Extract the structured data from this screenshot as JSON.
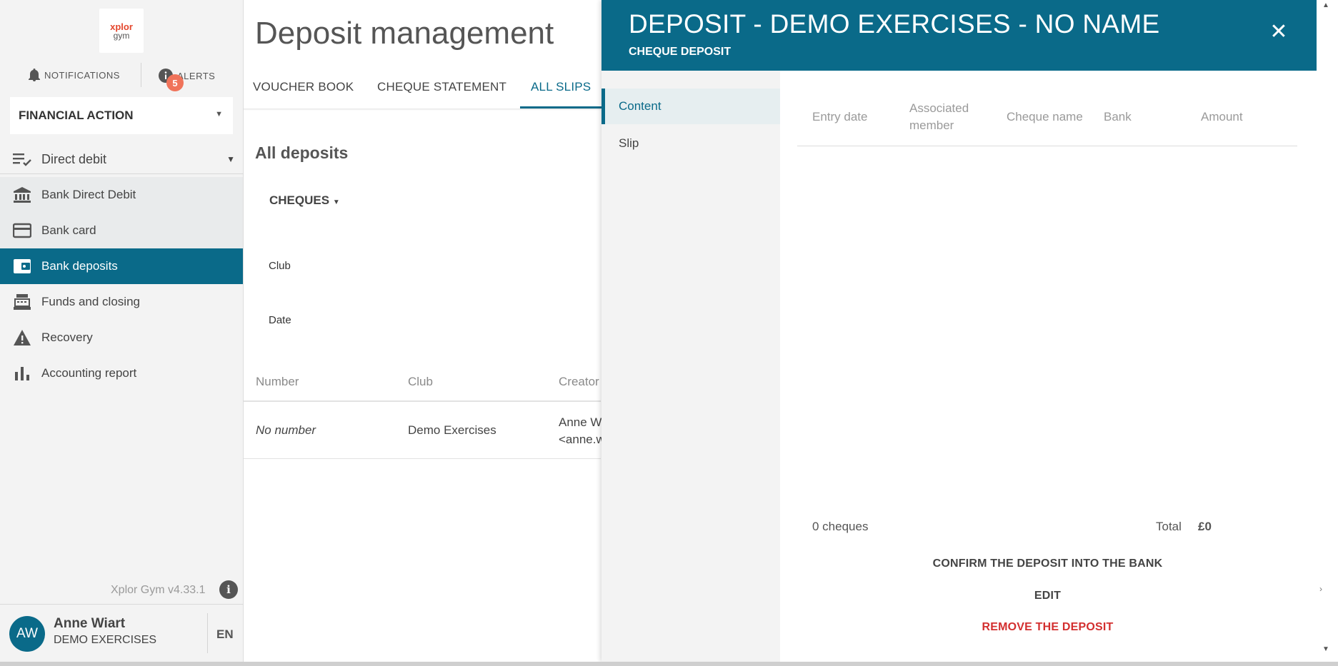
{
  "sidebar": {
    "logo_top": "xplor",
    "logo_bottom": "gym",
    "notifications_label": "NOTIFICATIONS",
    "alerts_label": "ALERTS",
    "alerts_count": "5",
    "financial_select": "FINANCIAL ACTION",
    "group_label": "Direct debit",
    "items": [
      {
        "label": "Bank Direct Debit",
        "icon": "bank-icon"
      },
      {
        "label": "Bank card",
        "icon": "credit-card-icon"
      },
      {
        "label": "Bank deposits",
        "icon": "wallet-icon"
      },
      {
        "label": "Funds and closing",
        "icon": "cash-register-icon"
      },
      {
        "label": "Recovery",
        "icon": "warning-icon"
      },
      {
        "label": "Accounting report",
        "icon": "bar-chart-icon"
      }
    ],
    "version": "Xplor Gym v4.33.1",
    "user": {
      "initials": "AW",
      "name": "Anne Wiart",
      "club": "DEMO EXERCISES",
      "lang": "EN"
    }
  },
  "main": {
    "title": "Deposit management",
    "tabs": [
      "VOUCHER BOOK",
      "CHEQUE STATEMENT",
      "ALL SLIPS"
    ],
    "section_title": "All deposits",
    "type_dropdown": "CHEQUES",
    "filters": {
      "club_label": "Club",
      "date_label": "Date"
    },
    "table": {
      "headers": [
        "Number",
        "Club",
        "Creator"
      ],
      "rows": [
        {
          "number": "No number",
          "club": "Demo Exercises",
          "creator_line1": "Anne W",
          "creator_line2": "<anne.w"
        }
      ]
    }
  },
  "drawer": {
    "title": "DEPOSIT - DEMO EXERCISES - NO NAME",
    "subtitle": "CHEQUE DEPOSIT",
    "nav": [
      "Content",
      "Slip"
    ],
    "columns": {
      "entry_date": "Entry date",
      "associated_line1": "Associated",
      "associated_line2": "member",
      "cheque_name": "Cheque name",
      "bank": "Bank",
      "amount": "Amount"
    },
    "count": "0 cheques",
    "total_label": "Total",
    "total_value": "£0",
    "actions": {
      "confirm": "CONFIRM THE DEPOSIT INTO THE BANK",
      "edit": "EDIT",
      "remove": "REMOVE THE DEPOSIT"
    }
  },
  "colors": {
    "accent": "#0a6a89",
    "danger": "#d32f2f",
    "badge": "#f0735a"
  }
}
